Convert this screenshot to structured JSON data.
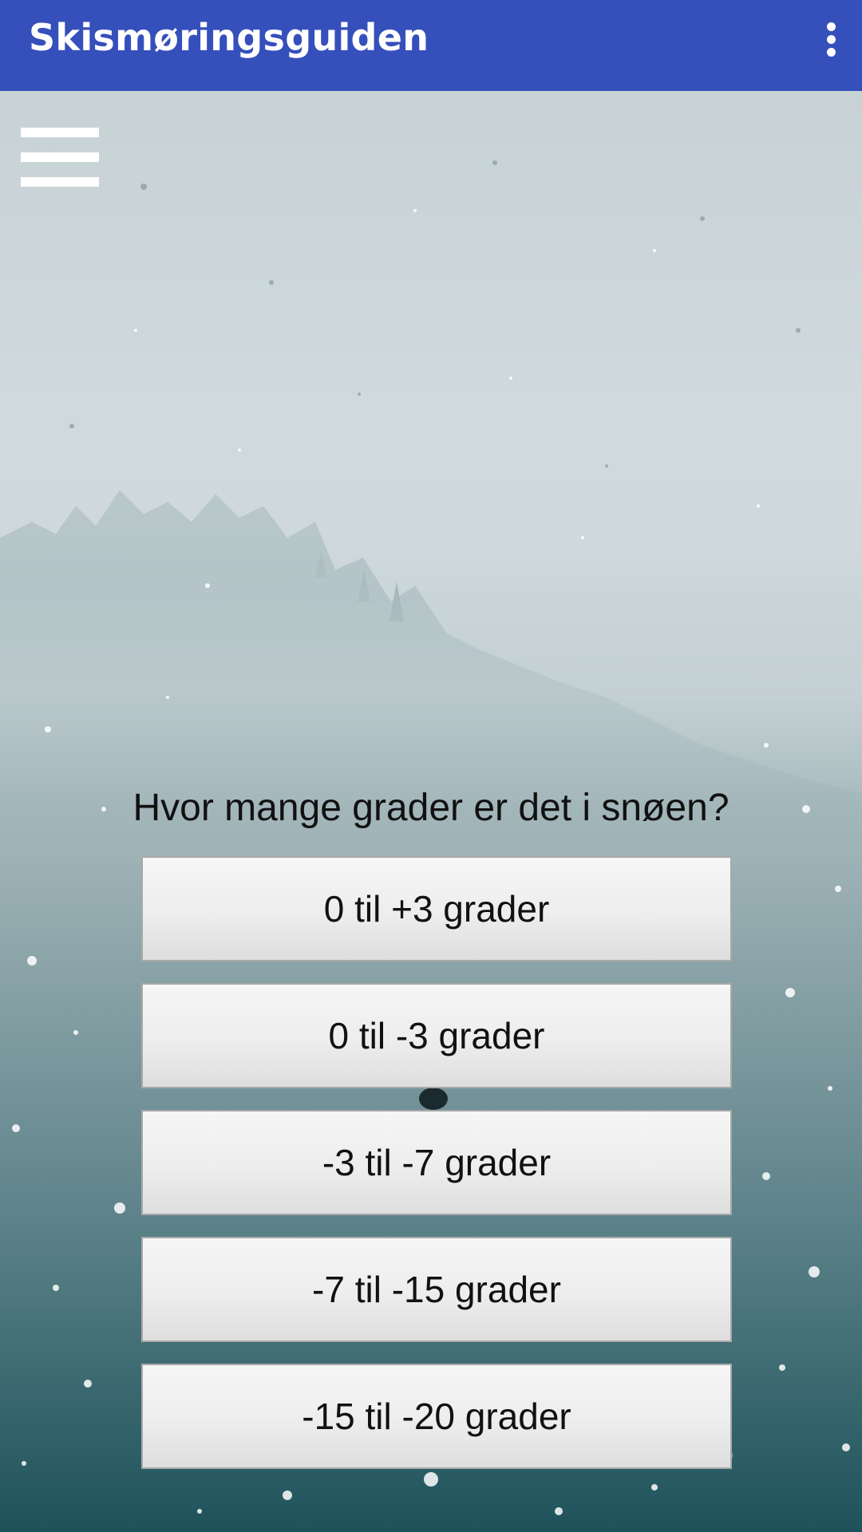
{
  "app_bar": {
    "title": "Skismøringsguiden",
    "overflow_icon": "more-vert-icon",
    "background_color": "#354fbb"
  },
  "menu": {
    "icon": "hamburger-menu-icon"
  },
  "question": {
    "text": "Hvor mange grader er det i snøen?"
  },
  "options": [
    {
      "label": "0 til +3 grader"
    },
    {
      "label": "0 til -3 grader"
    },
    {
      "label": "-3 til -7 grader"
    },
    {
      "label": "-7 til -15 grader"
    },
    {
      "label": "-15 til -20 grader"
    }
  ]
}
